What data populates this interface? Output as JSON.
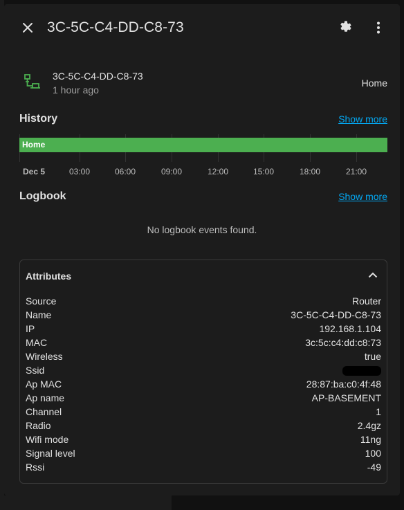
{
  "dialog": {
    "title": "3C-5C-C4-DD-C8-73",
    "close_icon": "close-icon",
    "settings_icon": "gear-icon",
    "menu_icon": "more-vert-icon"
  },
  "entity": {
    "name": "3C-5C-C4-DD-C8-73",
    "last_changed": "1 hour ago",
    "state": "Home",
    "icon": "lan-icon",
    "icon_color": "#4caf50"
  },
  "history": {
    "title": "History",
    "show_more": "Show more",
    "bar_label": "Home",
    "bar_color": "#4caf50",
    "ticks": [
      "Dec 5",
      "03:00",
      "06:00",
      "09:00",
      "12:00",
      "15:00",
      "18:00",
      "21:00"
    ]
  },
  "logbook": {
    "title": "Logbook",
    "show_more": "Show more",
    "empty": "No logbook events found."
  },
  "attributes": {
    "title": "Attributes",
    "toggle_icon": "chevron-up-icon",
    "rows": [
      {
        "key": "Source",
        "value": "Router"
      },
      {
        "key": "Name",
        "value": "3C-5C-C4-DD-C8-73"
      },
      {
        "key": "IP",
        "value": "192.168.1.104"
      },
      {
        "key": "MAC",
        "value": "3c:5c:c4:dd:c8:73"
      },
      {
        "key": "Wireless",
        "value": "true"
      },
      {
        "key": "Ssid",
        "value": ""
      },
      {
        "key": "Ap MAC",
        "value": "28:87:ba:c0:4f:48"
      },
      {
        "key": "Ap name",
        "value": "AP-BASEMENT"
      },
      {
        "key": "Channel",
        "value": "1"
      },
      {
        "key": "Radio",
        "value": "2.4gz"
      },
      {
        "key": "Wifi mode",
        "value": "11ng"
      },
      {
        "key": "Signal level",
        "value": "100"
      },
      {
        "key": "Rssi",
        "value": "-49"
      }
    ]
  },
  "colors": {
    "accent_link": "#03a9f4",
    "dialog_bg": "#1c1c1c"
  }
}
